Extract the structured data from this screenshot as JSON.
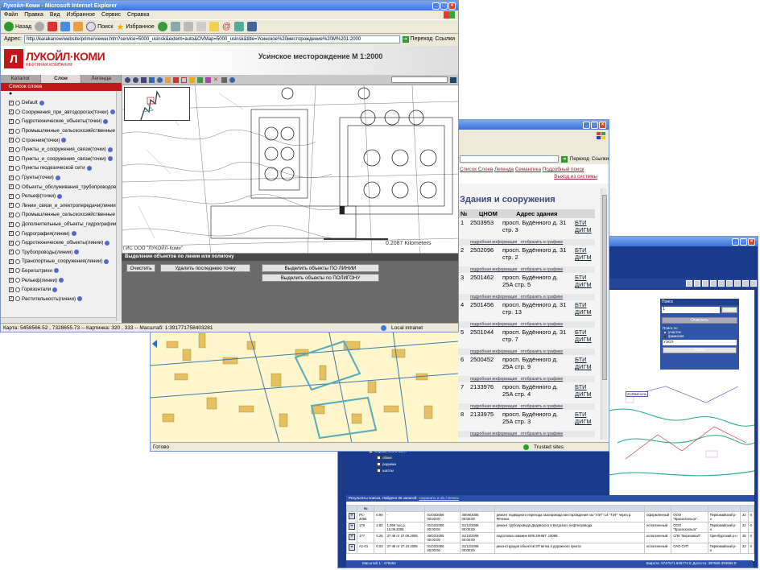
{
  "win1": {
    "title": "Лукойл-Коми - Microsoft Internet Explorer",
    "menu": [
      "Файл",
      "Правка",
      "Вид",
      "Избранное",
      "Сервис",
      "Справка"
    ],
    "toolbar": {
      "back": "Назад",
      "search": "Поиск",
      "favorites": "Избранное"
    },
    "address_label": "Адрес:",
    "address": "http://karakanow/website/prime/viewer.htm?service=5000_usinsk&extent=auto&OVMap=5000_usinsk&title=Усинское%20месторождение%20М%201:2000",
    "go": "Переход",
    "links": "Ссылки",
    "logo": "ЛУКОЙЛ·КОМИ",
    "logo_sub": "НЕФТЯНАЯ КОМПАНИЯ",
    "map_title": "Усинское месторождение М 1:2000",
    "tabs": [
      "Каталог",
      "Слои",
      "Легенда"
    ],
    "layers_header": "Список слоев",
    "layers": [
      "Default",
      "Сооружения_при_автодорогах(точки)",
      "Гидротехнические_объекты(точки)",
      "Промышленные_сельскохозяйственные (точки)",
      "Строения(точки)",
      "Пункты_и_сооружения_связи(точки)",
      "Пункты_и_сооружения_связи(точки)",
      "Пункты геодезической сети",
      "Грунты(точки)",
      "Объекты_обслуживания_трубопроводов",
      "Рельеф(точки)",
      "Линии_связи_и_электропередачи(линии)",
      "Промышленные_сельскохозяйственные (линии)",
      "Дополнительные_объекты_гидрографии",
      "Гидрография(линии)",
      "Гидротехнические_объекты(линии)",
      "Трубопроводы(линии)",
      "Транспортные_сооружения(линии)",
      "Берегштрихи",
      "Рельеф(линии)",
      "Горизонтали",
      "Растительность(линии)"
    ],
    "copyright": "ГИС ООО \"ЛУКОЙЛ-Коми\"",
    "scale_text": "0.2087 Kilometers",
    "select_header": "Выделение объектов по линии или полигону",
    "btn_clear": "Очистить",
    "btn_delete_last": "Удалить последнюю точку",
    "btn_by_line": "Выделить объекты ПО ЛИНИИ",
    "btn_by_polygon": "Выделить объекты по ПОЛИГОНУ",
    "status": "Карта: 5458566.52 , 7328655.73 -- Картинка: 320 , 333 -- Масштаб: 1:391771758403281",
    "zone": "Local intranet"
  },
  "win2": {
    "go": "Переход",
    "links": "Ссылки",
    "nav_links": [
      "Список Слоев",
      "Легенда",
      "Семантика",
      "Подробный поиск"
    ],
    "exit": "Выход из системы",
    "heading": "Здания и сооружения",
    "columns": [
      "№",
      "ЦНОМ",
      "Адрес здания",
      ""
    ],
    "detail_link": "подробная информация",
    "show_link": "отобразить в графике",
    "bti1": "БТИ",
    "bti2": "ДИГМ",
    "rows": [
      {
        "n": "1",
        "code": "2503953",
        "addr": "просп. Будённого д. 31 стр. 3"
      },
      {
        "n": "2",
        "code": "2502096",
        "addr": "просп. Будённого д. 31 стр. 2"
      },
      {
        "n": "3",
        "code": "2501462",
        "addr": "просп. Будённого д. 25А стр. 5"
      },
      {
        "n": "4",
        "code": "2501456",
        "addr": "просп. Будённого д. 31 стр. 13"
      },
      {
        "n": "5",
        "code": "2501044",
        "addr": "просп. Будённого д. 31 стр. 7"
      },
      {
        "n": "6",
        "code": "2500452",
        "addr": "просп. Будённого д. 25А стр. 9"
      },
      {
        "n": "7",
        "code": "2133976",
        "addr": "просп. Будённого д. 25А стр. 4"
      },
      {
        "n": "8",
        "code": "2133975",
        "addr": "просп. Будённого д. 25А стр. 3"
      }
    ],
    "status": "Готово",
    "trusted": "Trusted sites"
  },
  "win3": {
    "search_title": "Поиск",
    "search_value": "1",
    "find": "Найти",
    "clear": "Очистить",
    "search_by": "Поиск по",
    "opt1": "участок",
    "opt2": "фамилия",
    "select_value": "УЭСП",
    "find2": "Найти",
    "results_title": "Результаты поиска. Найдено 36 записей",
    "results_link": "сохранить в xls / печать",
    "tree_items": [
      "Справочник в жатл",
      "обжиг",
      "родники",
      "шатлы"
    ],
    "map_label": "2136м/ноль",
    "rows": [
      {
        "id": "PC-2056",
        "col2": "0.90",
        "col3": "-",
        "d1": "01/03/2006 00:00:00",
        "d2": "30/06/2006 00:00:00",
        "desc": "ремонт подводного перехода газопровода месторождения газ \"УЭТ\" 14 \"ТЭТ\" через р. Реченка",
        "type": "оформленный",
        "org": "ООО \"Красносельск\"",
        "place": "Первомайский р-н",
        "n1": "22",
        "n2": "0"
      },
      {
        "id": "179",
        "col2": "2.84",
        "col3": "1,059 тыс.р. 15.09.2005",
        "d1": "01/03/2006 00:00:00",
        "d2": "31/12/2006 00:00:00",
        "desc": "ремонт трубопровода Дедовского и Бегдского нефтепровода",
        "type": "исполненный",
        "org": "ООО \"Красносельск\"",
        "place": "Первомайский р-н",
        "n1": "22",
        "n2": "0"
      },
      {
        "id": "177",
        "col2": "0.25",
        "col3": "37-48 от 27.09.2005",
        "d1": "06/02/2006 00:00:00",
        "d2": "31/10/2006 00:00:00",
        "desc": "подготовка скважин ВЛК 28НМТ. 10088",
        "type": "исполненный",
        "org": "СПК \"Березовый\"",
        "place": "Оренбургский р-н",
        "n1": "25",
        "n2": "0"
      },
      {
        "id": "A1-01",
        "col2": "0.03",
        "col3": "37-46 от 27.10.2005",
        "d1": "01/03/2006 00:00:00",
        "d2": "31/12/2006 00:00:00",
        "desc": "реконструкция объектов ЗП ветка 3 дорожного пункта",
        "type": "исполненный",
        "org": "ОАО СУП",
        "place": "Первомайский р-н",
        "n1": "22",
        "n2": "0"
      }
    ],
    "status_scale": "Масштаб 1 : 479464",
    "status_coords": "Широта: 5747571.846774 Е Долгота: 397666.394856 Е"
  }
}
